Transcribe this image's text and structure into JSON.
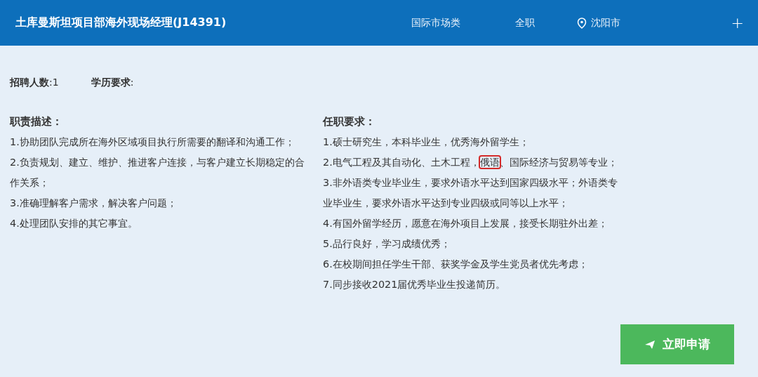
{
  "header": {
    "title": "土库曼斯坦项目部海外现场经理(J14391)",
    "category": "国际市场类",
    "job_type": "全职",
    "location": "沈阳市",
    "expand_icon": "+"
  },
  "summary": [
    {
      "label": "招聘人数",
      "value": ":1"
    },
    {
      "label": "学历要求",
      "value": ":"
    }
  ],
  "duties": {
    "heading": "职责描述：",
    "items": [
      {
        "parts": [
          {
            "text": "1.协助团队完成所在海外区域项目执行所需要的翻译和沟通工作；"
          }
        ]
      },
      {
        "parts": [
          {
            "text": "2.负责规划、建立、维护、推进客户连接，与客户建立长期稳定的合作关系；"
          }
        ]
      },
      {
        "parts": [
          {
            "text": "3.准确理解客户需求，解决客户问题；"
          }
        ]
      },
      {
        "parts": [
          {
            "text": "4.处理团队安排的其它事宜。"
          }
        ]
      }
    ]
  },
  "requirements": {
    "heading": "任职要求：",
    "items": [
      {
        "parts": [
          {
            "text": "1.硕士研究生，本科毕业生，优秀海外留学生；"
          }
        ]
      },
      {
        "parts": [
          {
            "text": "2.电气工程及其自动化、土木工程，"
          },
          {
            "text": "俄语",
            "highlighted": true
          },
          {
            "text": "、国际经济与贸易等专业；"
          }
        ]
      },
      {
        "parts": [
          {
            "text": "3.非外语类专业毕业生，要求外语水平达到国家四级水平；外语类专业毕业生，要求外语水平达到专业四级或同等以上水平；"
          }
        ]
      },
      {
        "parts": [
          {
            "text": "4.有国外留学经历，愿意在海外项目上发展，接受长期驻外出差；"
          }
        ]
      },
      {
        "parts": [
          {
            "text": "5.品行良好，学习成绩优秀；"
          }
        ]
      },
      {
        "parts": [
          {
            "text": "6.在校期间担任学生干部、获奖学金及学生党员者优先考虑；"
          }
        ]
      },
      {
        "parts": [
          {
            "text": "7.同步接收2021届优秀毕业生投递简历。"
          }
        ]
      }
    ]
  },
  "apply_button": "立即申请"
}
